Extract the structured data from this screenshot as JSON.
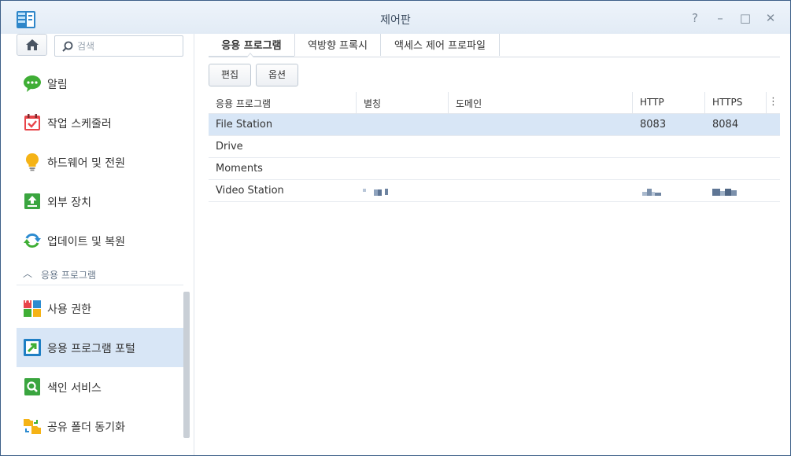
{
  "window": {
    "title": "제어판",
    "controls": [
      "?",
      "–",
      "□",
      "✕"
    ]
  },
  "sidebar": {
    "search_placeholder": "검색",
    "items": [
      {
        "label": "알림",
        "icon": "chat-bubble-icon"
      },
      {
        "label": "작업 스케줄러",
        "icon": "calendar-icon"
      },
      {
        "label": "하드웨어 및 전원",
        "icon": "lightbulb-icon"
      },
      {
        "label": "외부 장치",
        "icon": "upload-icon"
      },
      {
        "label": "업데이트 및 복원",
        "icon": "refresh-icon"
      }
    ],
    "group": {
      "label": "응용 프로그램",
      "collapsed": false
    },
    "group_items": [
      {
        "label": "사용 권한",
        "icon": "permissions-icon"
      },
      {
        "label": "응용 프로그램 포털",
        "icon": "portal-icon",
        "active": true
      },
      {
        "label": "색인 서비스",
        "icon": "search-index-icon"
      },
      {
        "label": "공유 폴더 동기화",
        "icon": "folder-sync-icon"
      }
    ]
  },
  "tabs": [
    {
      "label": "응용 프로그램",
      "active": true
    },
    {
      "label": "역방향 프록시",
      "active": false
    },
    {
      "label": "액세스 제어 프로파일",
      "active": false
    }
  ],
  "toolbar": {
    "edit_label": "편집",
    "options_label": "옵션"
  },
  "table": {
    "columns": [
      "응용 프로그램",
      "별칭",
      "도메인",
      "HTTP",
      "HTTPS"
    ],
    "rows": [
      {
        "app": "File Station",
        "alias": "",
        "domain": "",
        "http": "8083",
        "https": "8084",
        "selected": true
      },
      {
        "app": "Drive",
        "alias": "",
        "domain": "",
        "http": "",
        "https": ""
      },
      {
        "app": "Moments",
        "alias": "",
        "domain": "",
        "http": "",
        "https": ""
      },
      {
        "app": "Video Station",
        "alias": "",
        "domain": "",
        "http": "",
        "https": "",
        "redacted": true
      }
    ]
  },
  "colors": {
    "accent": "#d8e6f6",
    "titlebar": "#e6eef7",
    "border": "#3d5f88"
  }
}
